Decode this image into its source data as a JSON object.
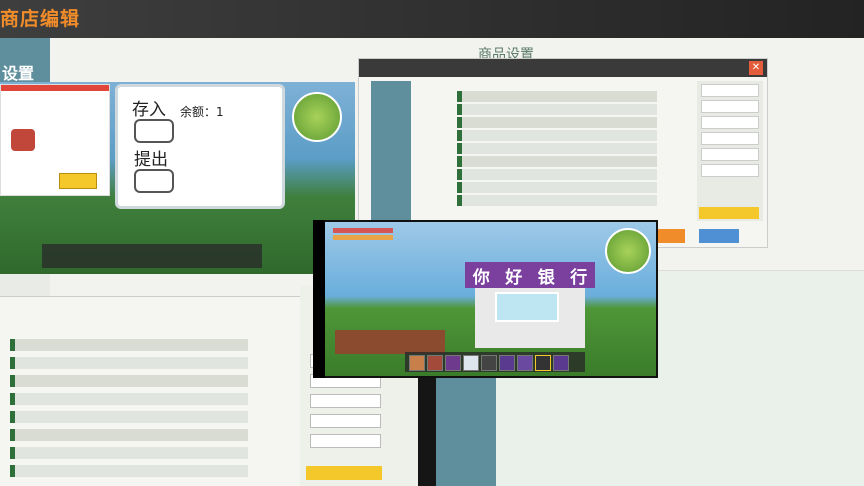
{
  "header": {
    "title": "商店编辑",
    "sidebar_label": "设置",
    "shop_settings_title": "商品设置"
  },
  "dialog_left": {
    "text": "",
    "confirm_label": ""
  },
  "bank_dialog": {
    "deposit_label": "存入",
    "balance_label": "余额：1",
    "withdraw_label": "提出"
  },
  "bank_sign": {
    "chars": [
      "你",
      "好",
      "银",
      "行"
    ]
  },
  "colors": {
    "accent": "#f08c2a",
    "sidebar": "#5f8f9d",
    "sign_purple": "#7b3f9e",
    "confirm_yellow": "#f4c72b"
  }
}
